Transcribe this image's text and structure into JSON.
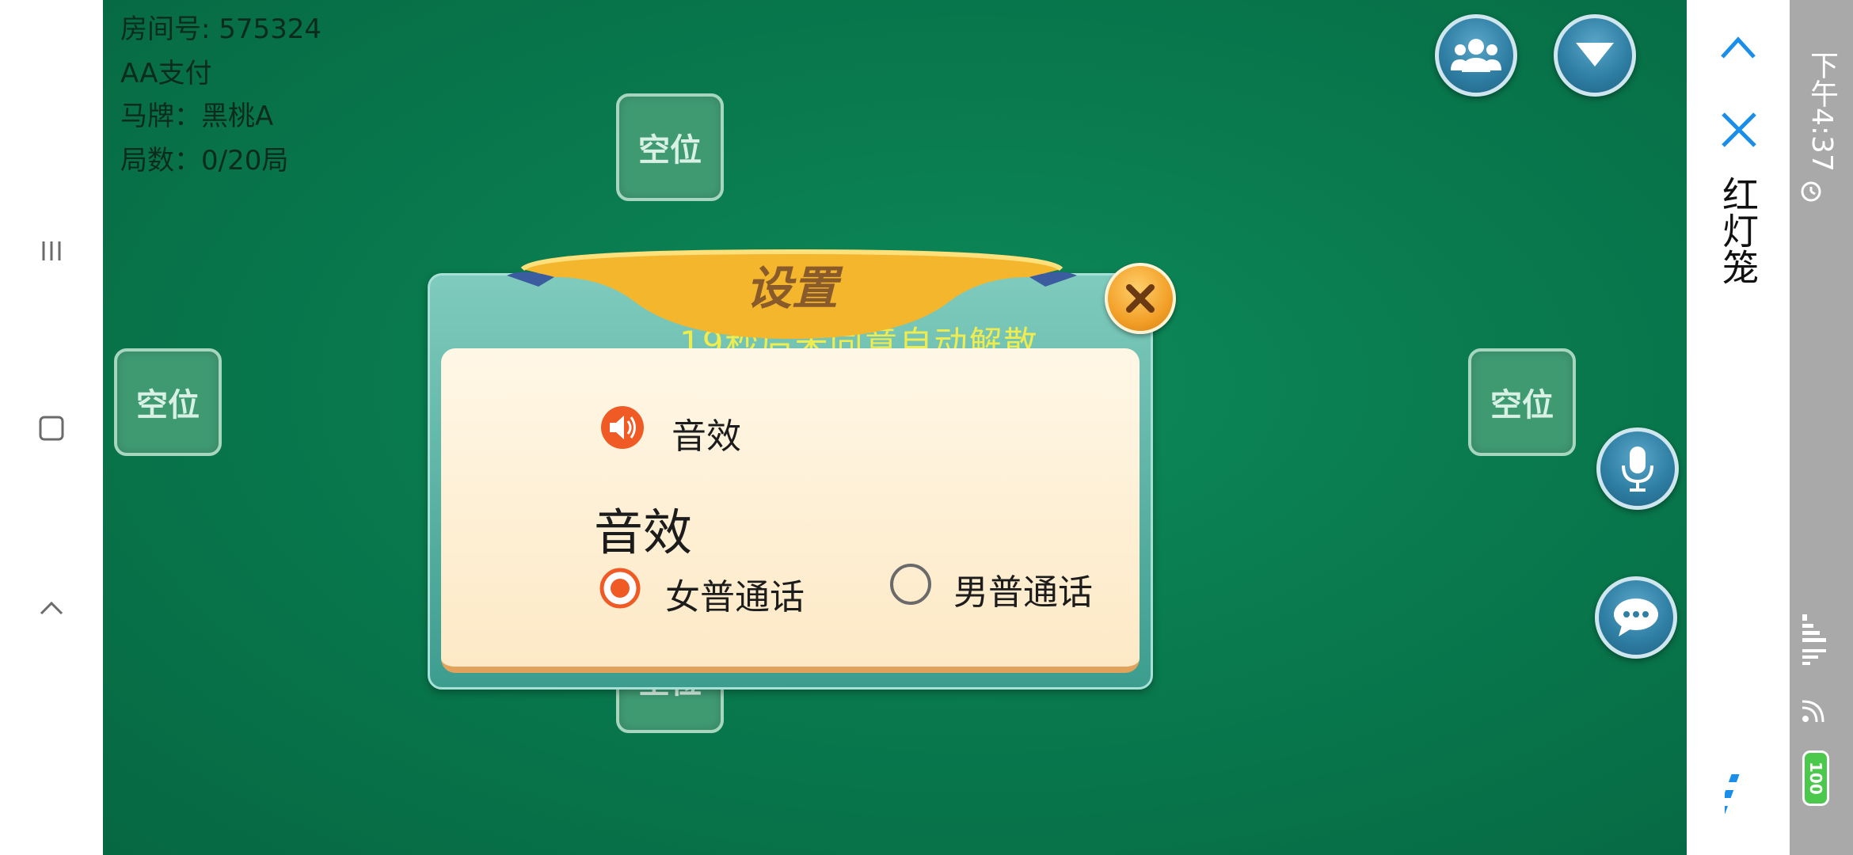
{
  "room": {
    "room_label": "房间号: 575324",
    "pay_label": "AA支付",
    "horse_card_label": "马牌：黑桃A",
    "rounds_label": "局数：0/20局"
  },
  "seats": {
    "top": "空位",
    "left": "空位",
    "right": "空位",
    "bottom": "空位"
  },
  "dialog": {
    "title": "设置",
    "behind_text": "19秒后未同意自动解散",
    "sound_toggle_label": "音效",
    "section_title": "音效",
    "voice_options": [
      "女普通话",
      "男普通话"
    ],
    "selected_voice": "女普通话"
  },
  "side_panel": {
    "title": "红灯笼"
  },
  "status_bar": {
    "time": "下午4:37",
    "battery": "100"
  },
  "colors": {
    "table_green": "#097a4e",
    "accent_orange": "#f05a24",
    "banner_gold": "#f2b42a",
    "nav_blue": "#1a8ee8",
    "battery_green": "#4cc94c"
  },
  "icons": [
    "menu-icon",
    "home-square-icon",
    "back-chevron-icon",
    "players-icon",
    "dropdown-arrow-icon",
    "microphone-icon",
    "chat-icon",
    "close-icon",
    "speaker-icon",
    "up-chevron-icon",
    "x-icon",
    "more-dots-icon",
    "alarm-icon",
    "signal-icon",
    "wifi-icon",
    "battery-icon"
  ]
}
